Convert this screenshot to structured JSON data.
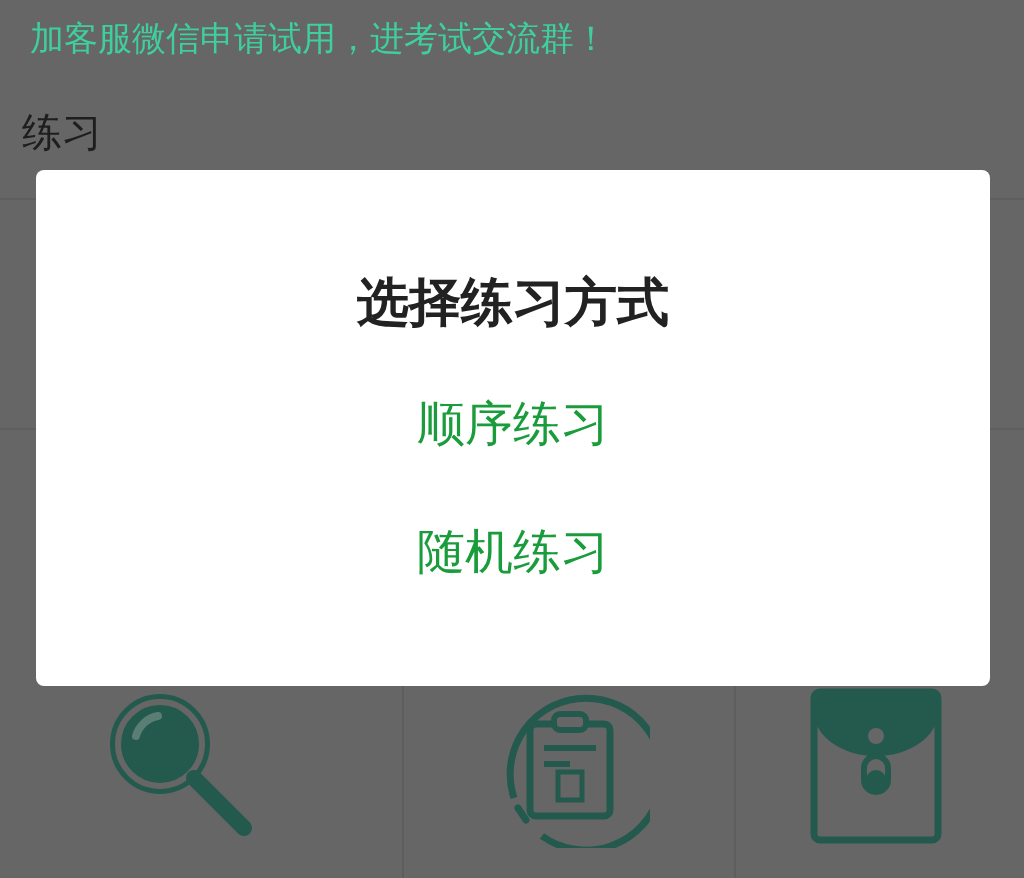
{
  "banner": {
    "text": "加客服微信申请试用，进考试交流群！"
  },
  "header": {
    "title": "练习"
  },
  "dialog": {
    "title": "选择练习方式",
    "options": [
      {
        "label": "顺序练习"
      },
      {
        "label": "随机练习"
      }
    ]
  }
}
